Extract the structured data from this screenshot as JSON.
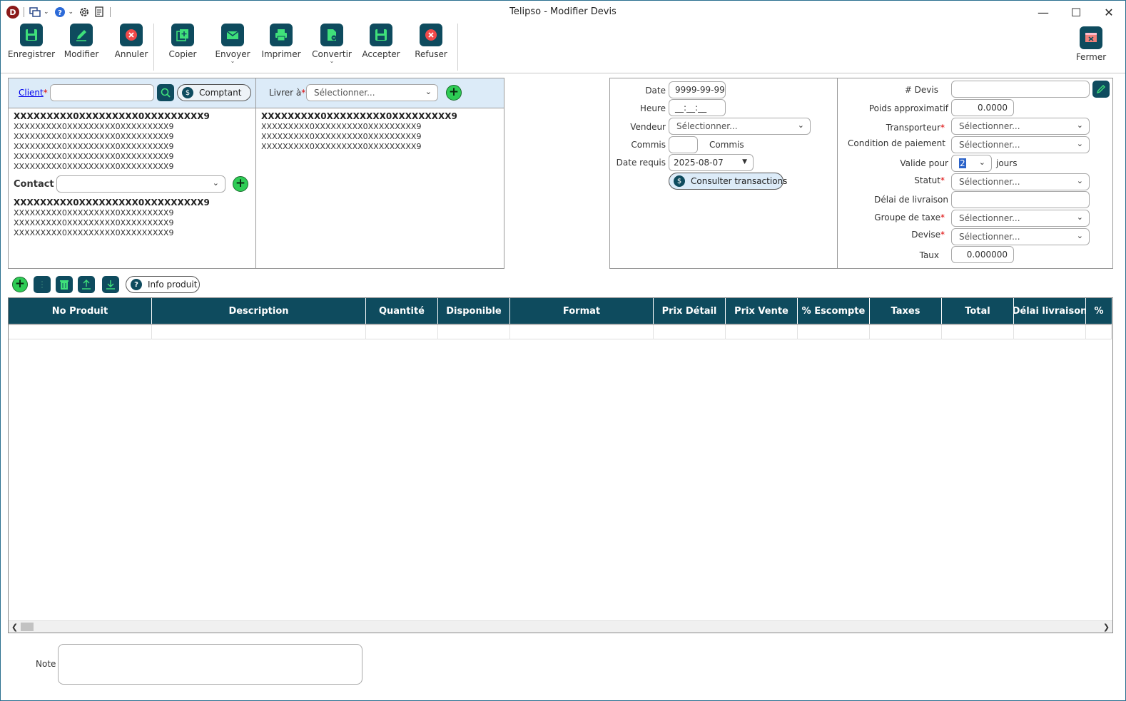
{
  "window": {
    "title": "Telipso - Modifier Devis",
    "logo_letter": "D"
  },
  "ribbon": {
    "enregistrer": "Enregistrer",
    "modifier": "Modifier",
    "annuler": "Annuler",
    "copier": "Copier",
    "envoyer": "Envoyer",
    "imprimer": "Imprimer",
    "convertir": "Convertir",
    "accepter": "Accepter",
    "refuser": "Refuser",
    "fermer": "Fermer"
  },
  "client": {
    "label": "Client",
    "value": "",
    "comptant_label": "Comptant",
    "address_bold": "XXXXXXXXX0XXXXXXXXX0XXXXXXXXX9",
    "address_lines": [
      "XXXXXXXXX0XXXXXXXXX0XXXXXXXXX9",
      "XXXXXXXXX0XXXXXXXXX0XXXXXXXXX9",
      "XXXXXXXXX0XXXXXXXXX0XXXXXXXXX9",
      "XXXXXXXXX0XXXXXXXXX0XXXXXXXXX9",
      "XXXXXXXXX0XXXXXXXXX0XXXXXXXXX9"
    ],
    "contact_label": "Contact",
    "contact_value": "",
    "contact_bold": "XXXXXXXXX0XXXXXXXXX0XXXXXXXXX9",
    "contact_lines": [
      "XXXXXXXXX0XXXXXXXXX0XXXXXXXXX9",
      "XXXXXXXXX0XXXXXXXXX0XXXXXXXXX9",
      "XXXXXXXXX0XXXXXXXXX0XXXXXXXXX9"
    ]
  },
  "livrer": {
    "label": "Livrer à",
    "select_value": "Sélectionner...",
    "address_bold": "XXXXXXXXX0XXXXXXXXX0XXXXXXXXX9",
    "address_lines": [
      "XXXXXXXXX0XXXXXXXXX0XXXXXXXXX9",
      "XXXXXXXXX0XXXXXXXXX0XXXXXXXXX9",
      "XXXXXXXXX0XXXXXXXXX0XXXXXXXXX9"
    ]
  },
  "info": {
    "date_label": "Date",
    "date_value": "9999-99-99",
    "heure_label": "Heure",
    "heure_value": "__:__:__",
    "vendeur_label": "Vendeur",
    "vendeur_value": "Sélectionner...",
    "commis_label": "Commis",
    "commis_value": "",
    "commis_suffix": "Commis",
    "date_requis_label": "Date requis",
    "date_requis_value": "2025-08-07",
    "consulter_label": "Consulter transactions"
  },
  "devis": {
    "devis_label": "# Devis",
    "devis_value": "",
    "poids_label": "Poids approximatif",
    "poids_value": "0.0000",
    "transporteur_label": "Transporteur",
    "transporteur_value": "Sélectionner...",
    "condition_label": "Condition de paiement",
    "condition_value": "Sélectionner...",
    "valide_label": "Valide pour",
    "valide_value": "2",
    "valide_suffix": "jours",
    "statut_label": "Statut",
    "statut_value": "Sélectionner...",
    "delai_label": "Délai de livraison",
    "delai_value": "",
    "groupe_label": "Groupe de taxe",
    "groupe_value": "Sélectionner...",
    "devise_label": "Devise",
    "devise_value": "Sélectionner...",
    "taux_label": "Taux",
    "taux_value": "0.000000"
  },
  "table_toolbar": {
    "info_produit": "Info produit"
  },
  "grid": {
    "columns": [
      "No Produit",
      "Description",
      "Quantité",
      "Disponible",
      "Format",
      "Prix Détail",
      "Prix Vente",
      "% Escompte",
      "Taxes",
      "Total",
      "Délai livraison",
      "%"
    ]
  },
  "note": {
    "label": "Note",
    "value": ""
  },
  "colors": {
    "accent_dark": "#0e4b5e",
    "header_blue": "#dcebf8",
    "green_plus": "#2ecc55",
    "required": "#dd0000"
  }
}
